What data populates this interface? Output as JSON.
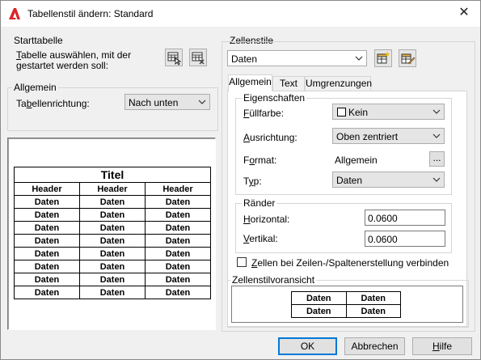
{
  "window": {
    "title": "Tabellenstil ändern: Standard",
    "close_glyph": "✕"
  },
  "start_table": {
    "legend": "Starttabelle",
    "line1": "Tabelle auswählen, mit der",
    "line2": "gestartet werden soll:"
  },
  "general": {
    "legend": "Allgemein",
    "direction_label": "Tabellenrichtung:",
    "direction_value": "Nach unten"
  },
  "preview": {
    "title": "Titel",
    "headers": [
      "Header",
      "Header",
      "Header"
    ],
    "rows": [
      [
        "Daten",
        "Daten",
        "Daten"
      ],
      [
        "Daten",
        "Daten",
        "Daten"
      ],
      [
        "Daten",
        "Daten",
        "Daten"
      ],
      [
        "Daten",
        "Daten",
        "Daten"
      ],
      [
        "Daten",
        "Daten",
        "Daten"
      ],
      [
        "Daten",
        "Daten",
        "Daten"
      ],
      [
        "Daten",
        "Daten",
        "Daten"
      ],
      [
        "Daten",
        "Daten",
        "Daten"
      ]
    ]
  },
  "cell_styles": {
    "legend": "Zellenstile",
    "selected": "Daten"
  },
  "tabs": [
    "Allgemein",
    "Text",
    "Umgrenzungen"
  ],
  "properties": {
    "legend": "Eigenschaften",
    "fill_label": "Füllfarbe:",
    "fill_value": "Kein",
    "align_label": "Ausrichtung:",
    "align_value": "Oben zentriert",
    "format_label": "Format:",
    "format_value": "Allgemein",
    "format_btn": "...",
    "type_label": "Typ:",
    "type_value": "Daten"
  },
  "margins": {
    "legend": "Ränder",
    "horizontal_label": "Horizontal:",
    "horizontal_value": "0.0600",
    "vertical_label": "Vertikal:",
    "vertical_value": "0.0600"
  },
  "merge_checkbox": "Zellen bei Zeilen-/Spaltenerstellung verbinden",
  "cell_preview": {
    "legend": "Zellenstilvoransicht",
    "cells": [
      [
        "Daten",
        "Daten"
      ],
      [
        "Daten",
        "Daten"
      ]
    ]
  },
  "buttons": {
    "ok": "OK",
    "cancel": "Abbrechen",
    "help": "Hilfe"
  },
  "colors": {
    "accent": "#0078d7",
    "app_icon": "#d9262a"
  }
}
